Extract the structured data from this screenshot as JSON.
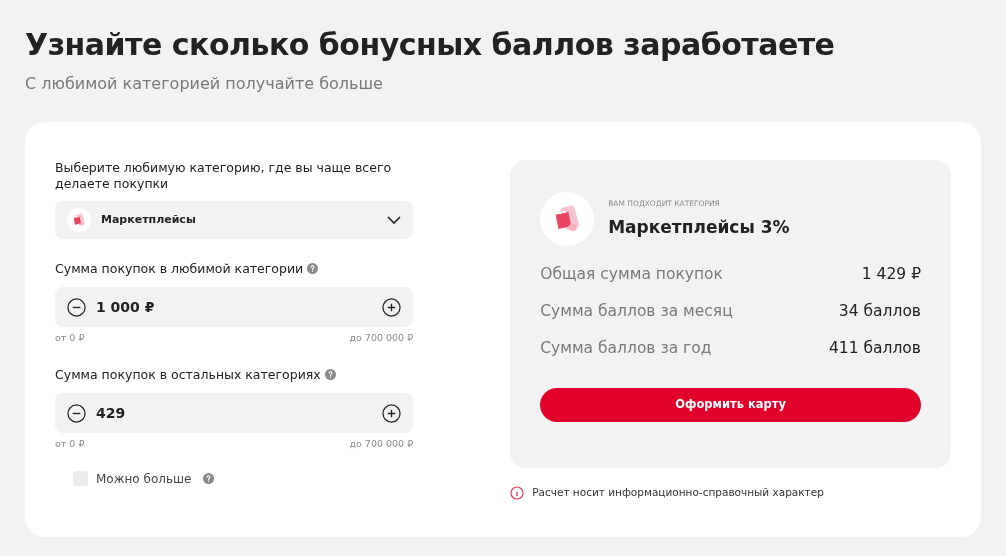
{
  "title": "Узнайте сколько бонусных баллов заработаете",
  "subtitle": "С любимой категорией получайте больше",
  "category": {
    "label": "Выберите любимую категорию, где вы чаще всего делаете покупки",
    "value": "Маркетплейсы"
  },
  "amounts": [
    {
      "label": "Сумма покупок в любимой категории",
      "value": "1 000 ₽",
      "min": "от 0 ₽",
      "max": "до 700 000 ₽"
    },
    {
      "label": "Сумма покупок в остальных категориях",
      "value": "429",
      "min": "от 0 ₽",
      "max": "до 700 000 ₽"
    }
  ],
  "more": {
    "label": "Можно больше",
    "checked": false
  },
  "result": {
    "caption": "ВАМ ПОДХОДИТ КАТЕГОРИЯ",
    "category": "Маркетплейсы 3%",
    "rows": [
      {
        "label": "Общая сумма покупок",
        "value": "1 429 ₽"
      },
      {
        "label": "Сумма баллов за месяц",
        "value": "34 баллов"
      },
      {
        "label": "Сумма баллов за год",
        "value": "411 баллов"
      }
    ],
    "button": "Оформить карту"
  },
  "note": "Расчет носит информационно-справочный характер"
}
